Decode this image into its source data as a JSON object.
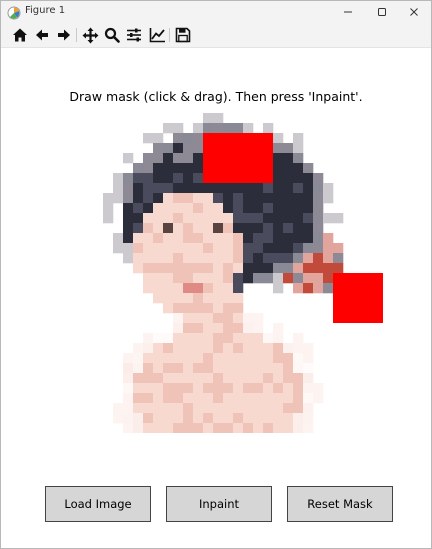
{
  "window": {
    "title": "Figure 1"
  },
  "toolbar": {
    "tools": [
      {
        "name": "home",
        "icon": "home-icon"
      },
      {
        "name": "back",
        "icon": "arrow-left-icon"
      },
      {
        "name": "forward",
        "icon": "arrow-right-icon"
      },
      {
        "name": "pan",
        "icon": "move-icon"
      },
      {
        "name": "zoom",
        "icon": "zoom-icon"
      },
      {
        "name": "configure-subplots",
        "icon": "sliders-icon"
      },
      {
        "name": "edit-axis",
        "icon": "line-chart-icon"
      },
      {
        "name": "save",
        "icon": "floppy-disk-icon"
      }
    ]
  },
  "figure": {
    "title": "Draw mask (click & drag). Then press 'Inpaint'."
  },
  "image": {
    "grid_size": 32,
    "palette": {
      "skin": "#f7d9d0",
      "skin_shade": "#f0c3b8",
      "hair_dark": "#2b2e3a",
      "hair_mid": "#4a4b5c",
      "hair_light": "#8e8a95",
      "lips": "#e08a86",
      "eye": "#5a4440",
      "accent_red": "#c24a3a",
      "background": "#ffffff",
      "mask": "#ff0000"
    },
    "masks": [
      {
        "col": 14,
        "row": 2,
        "cols": 7,
        "rows": 5
      },
      {
        "col": 20,
        "row": 3,
        "cols": 1,
        "rows": 4
      },
      {
        "col": 27,
        "row": 16,
        "cols": 5,
        "rows": 5
      }
    ]
  },
  "buttons": {
    "load_label": "Load Image",
    "inpaint_label": "Inpaint",
    "reset_label": "Reset Mask"
  }
}
